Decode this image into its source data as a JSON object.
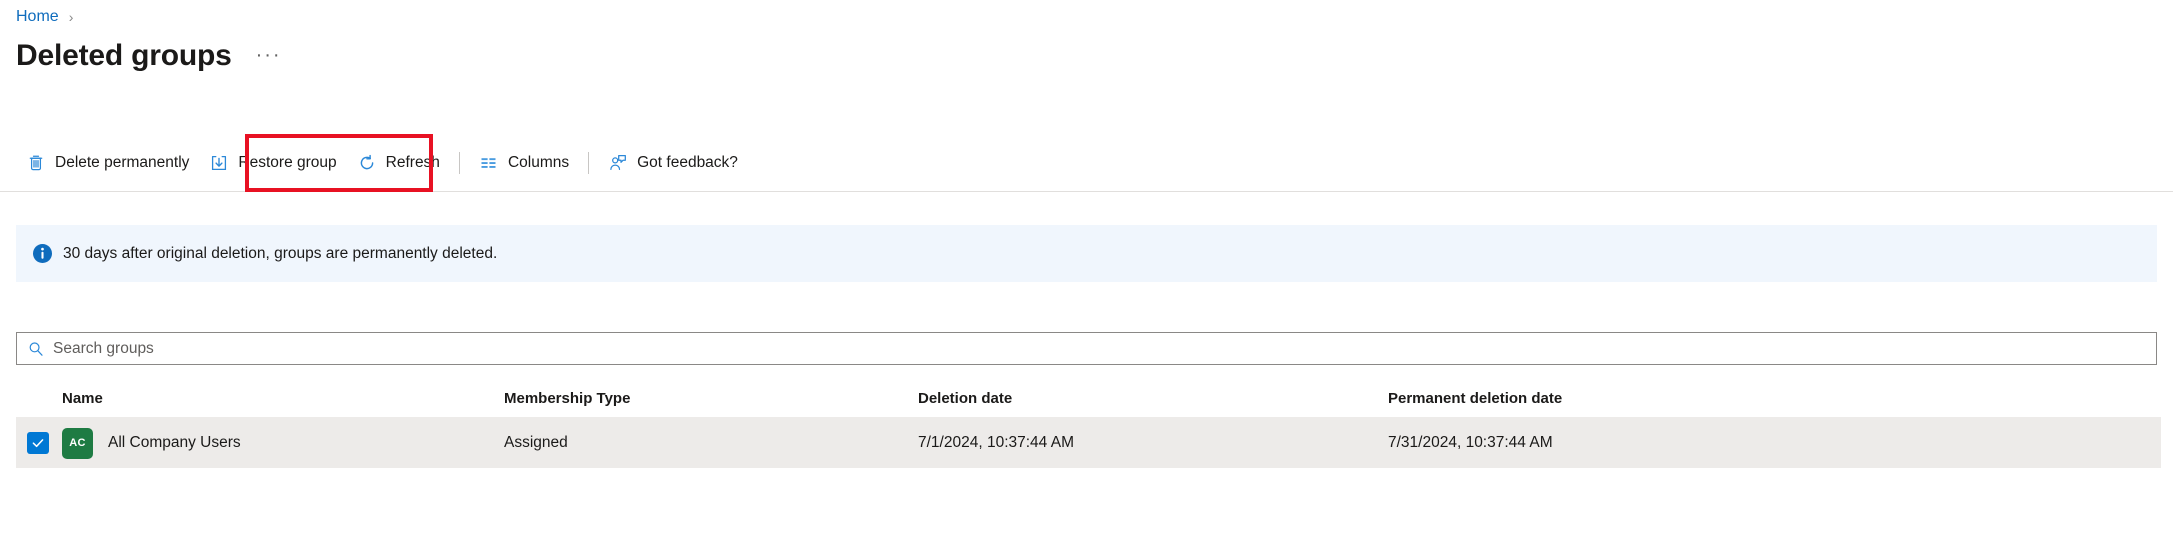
{
  "breadcrumb": {
    "items": [
      {
        "label": "Home",
        "icon": ""
      }
    ],
    "separator": "›"
  },
  "header": {
    "title": "Deleted groups",
    "overflow_label": "···"
  },
  "toolbar": {
    "buttons": [
      {
        "label": "Delete permanently",
        "icon": "trash-icon"
      },
      {
        "label": "Restore group",
        "icon": "restore-download-icon"
      },
      {
        "label": "Refresh",
        "icon": "refresh-icon"
      },
      {
        "label": "Columns",
        "icon": "columns-icon"
      },
      {
        "label": "Got feedback?",
        "icon": "feedback-person-icon"
      }
    ],
    "highlighted_button": "Restore group",
    "highlight_color": "#e81123"
  },
  "info_banner": {
    "icon": "info-icon",
    "message": "30 days after original deletion, groups are permanently deleted.",
    "background": "#f0f6fd",
    "icon_color": "#0f6cbd"
  },
  "search": {
    "placeholder": "Search groups",
    "value": "",
    "icon": "search-icon"
  },
  "table": {
    "columns": [
      {
        "key": "name",
        "label": "Name"
      },
      {
        "key": "membership_type",
        "label": "Membership Type"
      },
      {
        "key": "deletion_date",
        "label": "Deletion date"
      },
      {
        "key": "permanent_deletion_date",
        "label": "Permanent deletion date"
      }
    ],
    "rows": [
      {
        "selected": true,
        "avatar_initials": "AC",
        "avatar_color": "#1e7b43",
        "name": "All Company Users",
        "membership_type": "Assigned",
        "deletion_date": "7/1/2024, 10:37:44 AM",
        "permanent_deletion_date": "7/31/2024, 10:37:44 AM"
      }
    ],
    "selected_row_background": "#edebe9",
    "checkbox_color": "#0078d4"
  },
  "colors": {
    "accent": "#0f6cbd",
    "icon_blue": "#4a9ce0",
    "text": "#1b1a19"
  }
}
